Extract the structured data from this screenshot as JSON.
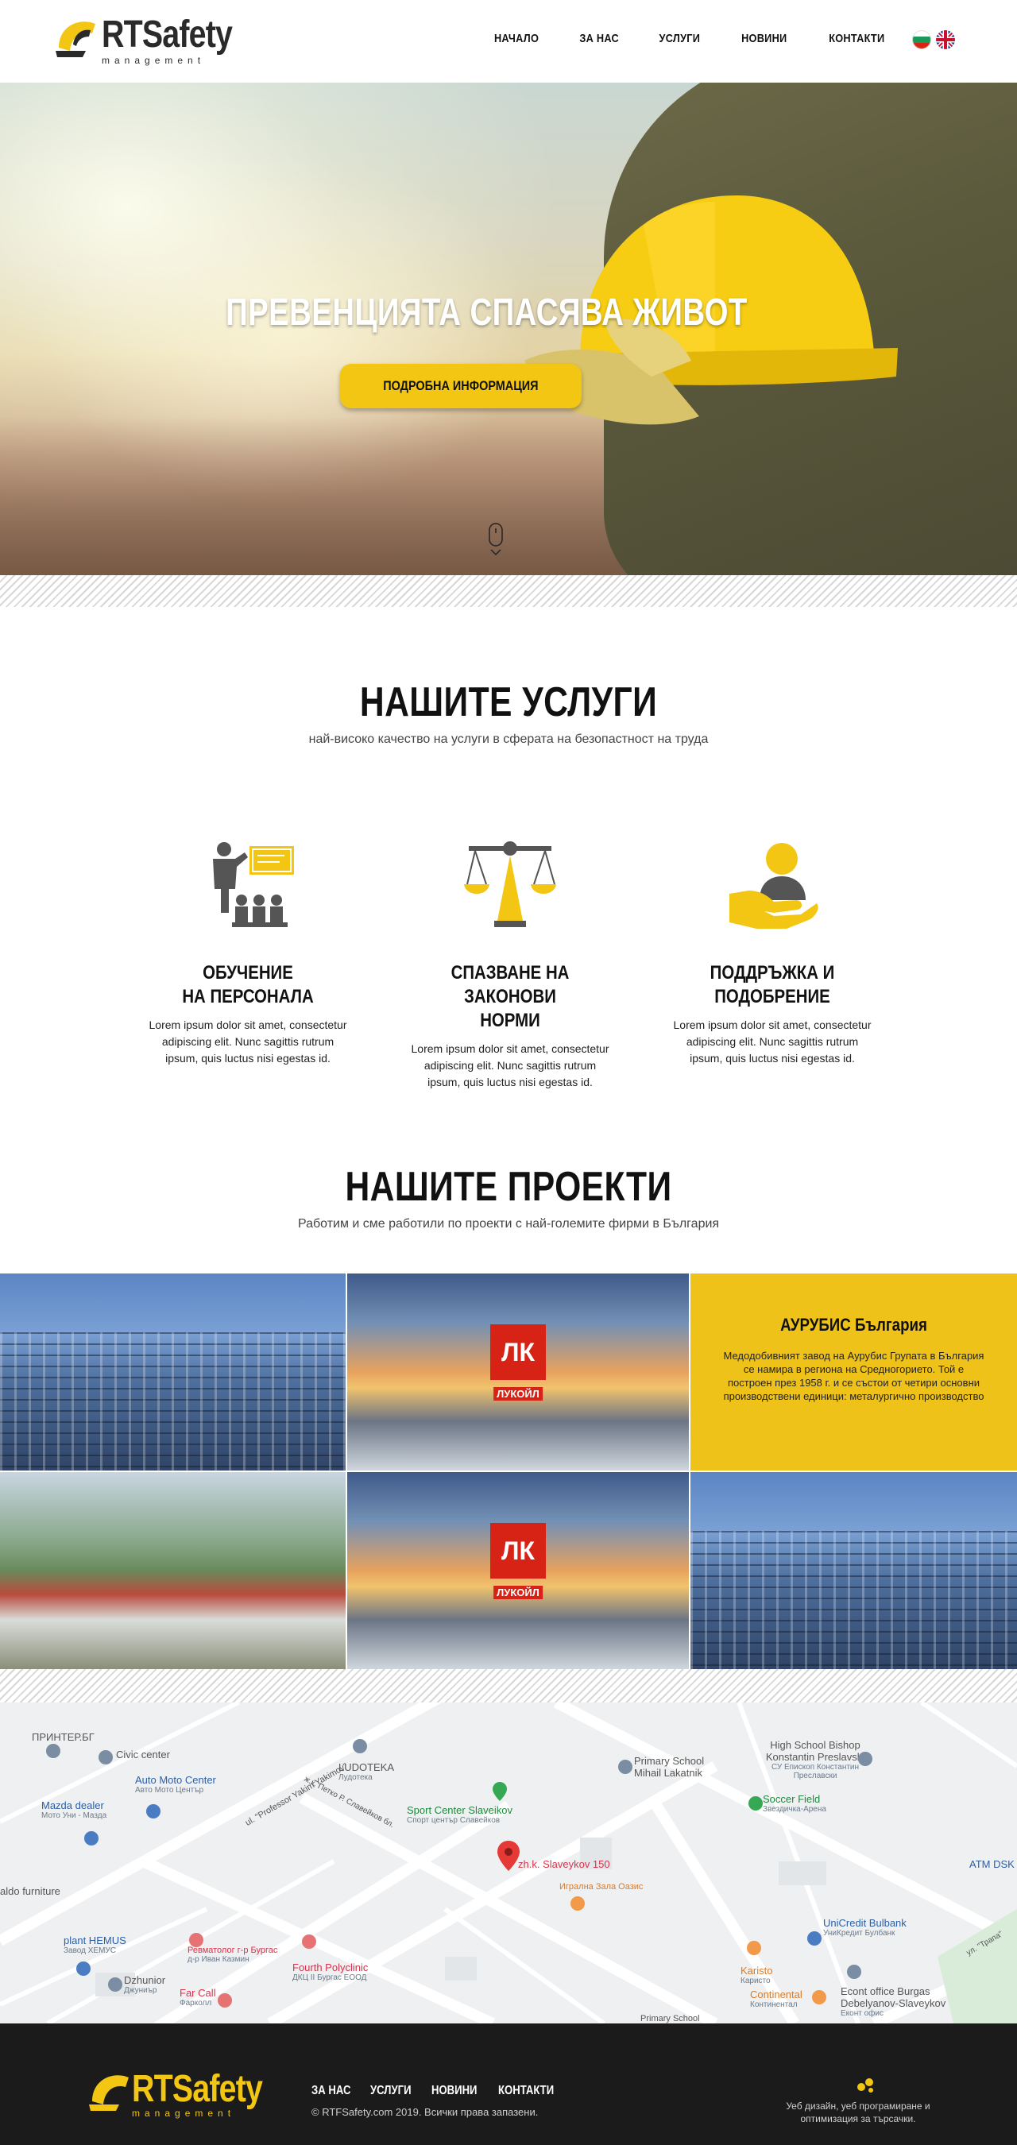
{
  "brand": {
    "logo_main": "RTSafety",
    "logo_sub": "management"
  },
  "nav": {
    "items": [
      "НАЧАЛО",
      "ЗА НАС",
      "УСЛУГИ",
      "НОВИНИ",
      "КОНТАКТИ"
    ],
    "languages": [
      "bg",
      "en"
    ]
  },
  "hero": {
    "title": "ПРЕВЕНЦИЯТА СПАСЯВА ЖИВОТ",
    "button_label": "ПОДРОБНА ИНФОРМАЦИЯ"
  },
  "services": {
    "title": "НАШИТЕ УСЛУГИ",
    "subtitle": "най-високо качество на услуги в сферата на безопастност на труда",
    "items": [
      {
        "icon": "training-icon",
        "title_line1": "ОБУЧЕНИЕ",
        "title_line2": "НА ПЕРСОНАЛА",
        "text": "Lorem ipsum dolor sit amet, consectetur adipiscing elit. Nunc sagittis rutrum ipsum, quis luctus nisi egestas id."
      },
      {
        "icon": "scales-icon",
        "title_line1": "СПАЗВАНЕ НА ЗАКОНОВИ",
        "title_line2": "НОРМИ",
        "text": "Lorem ipsum dolor sit amet, consectetur adipiscing elit. Nunc sagittis rutrum ipsum, quis luctus nisi egestas id."
      },
      {
        "icon": "support-hand-icon",
        "title_line1": "ПОДДРЪЖКА И",
        "title_line2": "ПОДОБРЕНИЕ",
        "text": "Lorem ipsum dolor sit amet, consectetur adipiscing elit. Nunc sagittis rutrum ipsum, quis luctus nisi egestas id."
      }
    ]
  },
  "projects": {
    "title": "НАШИТЕ ПРОЕКТИ",
    "subtitle": "Работим и сме работили по проекти с най-големите фирми в България",
    "info_title": "АУРУБИС България",
    "info_text": "Медодобивният завод на Аурубис Групата в България се намира в региона на Средногорието. Той е построен през 1958 г. и се състои от четири основни производствени единици: металургично производство",
    "lukoil_label": "ЛУКОЙЛ"
  },
  "map": {
    "labels": [
      {
        "text": "ПРИНТЕР.БГ",
        "cls": "grey"
      },
      {
        "text": "Civic center",
        "cls": "grey"
      },
      {
        "text": "Auto Moto Center",
        "sub": "Авто Мото Център",
        "cls": ""
      },
      {
        "text": "Mazda dealer",
        "sub": "Мото Уни - Мазда",
        "cls": ""
      },
      {
        "text": "LUDOTEKA",
        "sub": "Лудотека",
        "cls": "grey"
      },
      {
        "text": "Sport Center Slaveikov",
        "sub": "Спорт център Славейков",
        "cls": "green"
      },
      {
        "text": "zh.k. Slaveykov 150",
        "cls": "red"
      },
      {
        "text": "Игрална Зала Оазис",
        "cls": "orange"
      },
      {
        "text": "Primary School Mihail Lakatnik",
        "cls": "grey"
      },
      {
        "text": "High School Bishop Konstantin Preslavski",
        "sub": "СУ Епископ Константин Преславски",
        "cls": "grey"
      },
      {
        "text": "Soccer Field",
        "sub": "Звездичка-Арена",
        "cls": "green"
      },
      {
        "text": "ATM DSK",
        "cls": ""
      },
      {
        "text": "aldo furniture",
        "cls": "grey"
      },
      {
        "text": "plant HEMUS",
        "sub": "Завод ХЕМУС",
        "cls": ""
      },
      {
        "text": "Ревматолог г-р Бургас",
        "sub": "д-р Иван Казмин",
        "cls": "red"
      },
      {
        "text": "Fourth Polyclinic",
        "sub": "ДКЦ II Бургас ЕООД",
        "cls": "red"
      },
      {
        "text": "Dzhunior",
        "sub": "Джуниър",
        "cls": "grey"
      },
      {
        "text": "Far Call",
        "sub": "Фарколл",
        "cls": "red"
      },
      {
        "text": "UniCredit Bulbank",
        "sub": "УниКредит Булбанк",
        "cls": ""
      },
      {
        "text": "Karisto",
        "sub": "Каристо",
        "cls": "orange"
      },
      {
        "text": "Continental",
        "sub": "Континентал",
        "cls": "orange"
      },
      {
        "text": "Econt office Burgas Debelyanov-Slaveykov",
        "sub": "Еконт офис",
        "cls": "grey"
      },
      {
        "text": "Primary School",
        "cls": "grey"
      },
      {
        "text": "ul. \"Professor Yakim Yakimov\"",
        "cls": "grey"
      },
      {
        "text": "ж.к. Петко Р. Славейков бл.",
        "cls": "grey"
      },
      {
        "text": "ул. \"Трапа\"",
        "cls": "grey"
      }
    ]
  },
  "footer": {
    "nav": [
      "ЗА НАС",
      "УСЛУГИ",
      "НОВИНИ",
      "КОНТАКТИ"
    ],
    "copyright": "© RTFSafety.com 2019. Всички права запазени.",
    "dev_text": "Уеб дизайн, уеб програмиране и оптимизация за търсачки."
  },
  "colors": {
    "accent": "#f3c614",
    "footer_bg": "#1b1b1b",
    "text": "#111111"
  }
}
